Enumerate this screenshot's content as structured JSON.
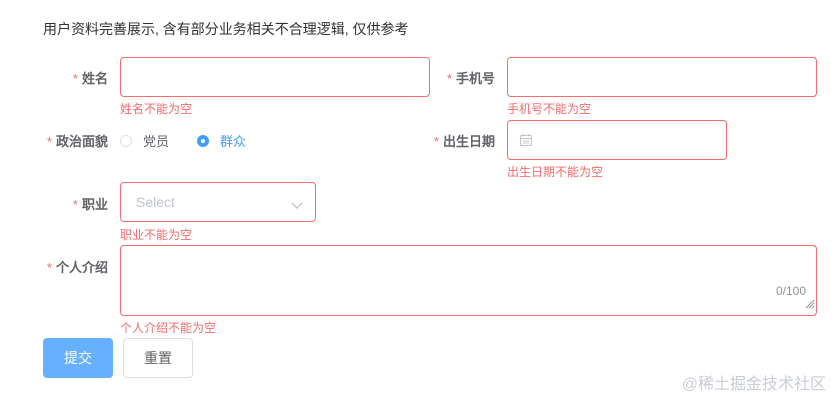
{
  "form": {
    "description": "用户资料完善展示, 含有部分业务相关不合理逻辑, 仅供参考",
    "required_mark": "*",
    "name": {
      "label": "姓名",
      "value": "",
      "error": "姓名不能为空"
    },
    "phone": {
      "label": "手机号",
      "value": "",
      "error": "手机号不能为空"
    },
    "political": {
      "label": "政治面貌",
      "options": [
        {
          "label": "党员",
          "checked": false
        },
        {
          "label": "群众",
          "checked": true
        }
      ]
    },
    "birthdate": {
      "label": "出生日期",
      "value": "",
      "icon": "calendar-icon",
      "error": "出生日期不能为空"
    },
    "job": {
      "label": "职业",
      "placeholder": "Select",
      "icon": "chevron-down-icon",
      "error": "职业不能为空"
    },
    "intro": {
      "label": "个人介绍",
      "value": "",
      "counter": "0/100",
      "error": "个人介绍不能为空"
    },
    "submit_label": "提交",
    "reset_label": "重置"
  },
  "watermark": "@稀土掘金技术社区",
  "colors": {
    "error": "#f56c6c",
    "primary": "#409eff",
    "primary_light": "#66b1ff",
    "label": "#606266",
    "placeholder": "#c0c4cc"
  }
}
